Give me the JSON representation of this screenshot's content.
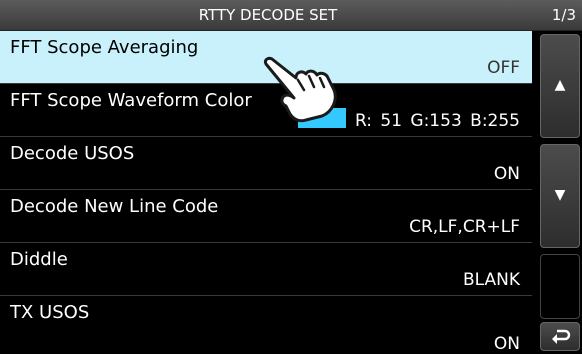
{
  "header": {
    "title": "RTTY DECODE SET",
    "page_indicator": "1/3"
  },
  "menu": {
    "items": [
      {
        "label": "FFT Scope Averaging",
        "value": "OFF"
      },
      {
        "label": "FFT Scope Waveform Color",
        "value": "R: 51 G:153 B:255",
        "swatch_color": "#33c9ff"
      },
      {
        "label": "Decode USOS",
        "value": "ON"
      },
      {
        "label": "Decode New Line Code",
        "value": "CR,LF,CR+LF"
      },
      {
        "label": "Diddle",
        "value": "BLANK"
      },
      {
        "label": "TX USOS",
        "value": "ON"
      }
    ]
  },
  "icons": {
    "scroll_up": "up-triangle-icon",
    "scroll_down": "down-triangle-icon",
    "back": "return-arrow-icon",
    "pointer": "pointing-hand-icon"
  },
  "colors": {
    "selected_row": "#c9f1fb",
    "swatch": "#33c9ff"
  }
}
